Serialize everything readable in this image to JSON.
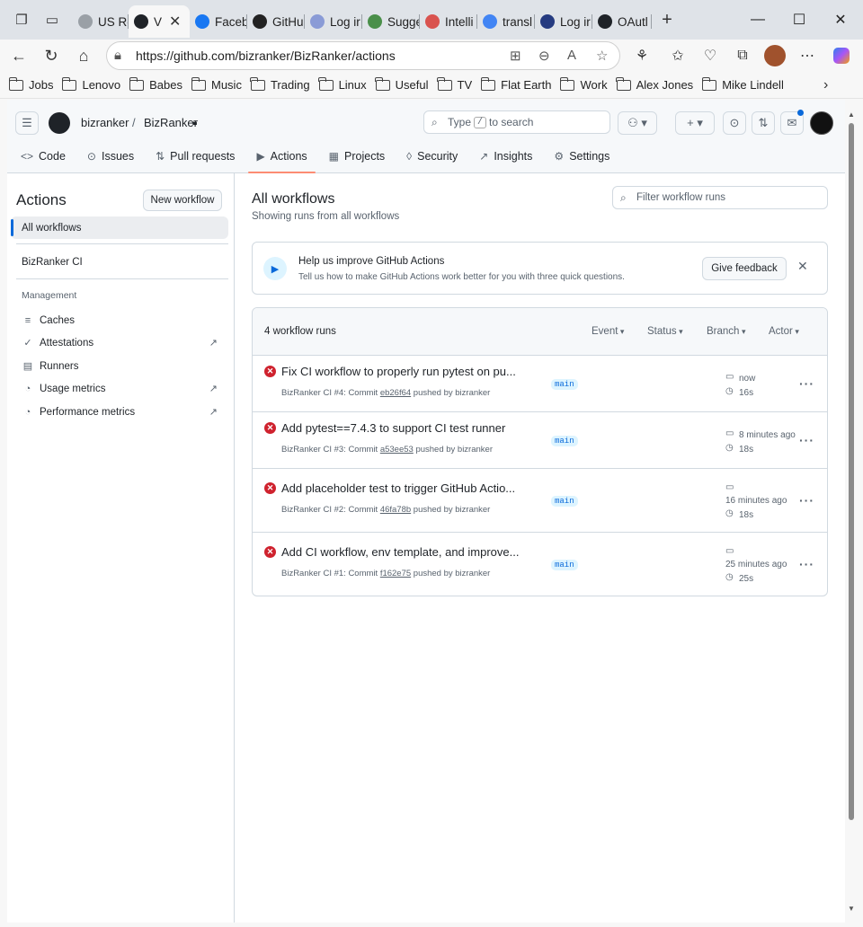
{
  "browser": {
    "tabs": [
      {
        "label": "US Re",
        "icon": "ghost-favicon",
        "color": "#9aa0a6"
      },
      {
        "label": "V",
        "icon": "github-favicon",
        "color": "#1f2328",
        "active": true
      },
      {
        "label": "Faceb",
        "icon": "facebook-favicon",
        "color": "#1877f2"
      },
      {
        "label": "GitHu",
        "icon": "openai-favicon",
        "color": "#222222"
      },
      {
        "label": "Log ir",
        "icon": "auth-favicon",
        "color": "#8a9bd6"
      },
      {
        "label": "Sugge",
        "icon": "download-favicon",
        "color": "#4a8f4a"
      },
      {
        "label": "Intelli",
        "icon": "d-favicon",
        "color": "#d9534f"
      },
      {
        "label": "transl",
        "icon": "google-favicon",
        "color": "#4285f4"
      },
      {
        "label": "Log ir",
        "icon": "paypal-favicon",
        "color": "#253b80"
      },
      {
        "label": "OAutl",
        "icon": "github-favicon",
        "color": "#1f2328"
      }
    ],
    "url": "https://github.com/bizranker/BizRanker/actions",
    "bookmarks": [
      "Jobs",
      "Lenovo",
      "Babes",
      "Music",
      "Trading",
      "Linux",
      "Useful",
      "TV",
      "Flat Earth",
      "Work",
      "Alex Jones",
      "Mike Lindell"
    ]
  },
  "header": {
    "owner": "bizranker",
    "separator": "/",
    "repo": "BizRanker",
    "search_prefix": "Type",
    "search_key": "/",
    "search_suffix": "to search"
  },
  "repo_nav": [
    {
      "label": "Code",
      "icon": "<>"
    },
    {
      "label": "Issues",
      "icon": "⊙"
    },
    {
      "label": "Pull requests",
      "icon": "⇅"
    },
    {
      "label": "Actions",
      "icon": "▶",
      "selected": true
    },
    {
      "label": "Projects",
      "icon": "▦"
    },
    {
      "label": "Security",
      "icon": "◊"
    },
    {
      "label": "Insights",
      "icon": "↗"
    },
    {
      "label": "Settings",
      "icon": "⚙"
    }
  ],
  "sidebar": {
    "title": "Actions",
    "new_workflow": "New workflow",
    "all_workflows": "All workflows",
    "workflow": "BizRanker CI",
    "management_heading": "Management",
    "management": [
      {
        "label": "Caches",
        "icon": "≡",
        "external": false
      },
      {
        "label": "Attestations",
        "icon": "✓",
        "external": true
      },
      {
        "label": "Runners",
        "icon": "▤",
        "external": false
      },
      {
        "label": "Usage metrics",
        "icon": "◔",
        "external": true
      },
      {
        "label": "Performance metrics",
        "icon": "◔",
        "external": true
      }
    ]
  },
  "main": {
    "title": "All workflows",
    "subtitle": "Showing runs from all workflows",
    "filter_placeholder": "Filter workflow runs",
    "feedback": {
      "title": "Help us improve GitHub Actions",
      "description": "Tell us how to make GitHub Actions work better for you with three quick questions.",
      "button": "Give feedback"
    },
    "runs_count": "4 workflow runs",
    "filters": [
      "Event",
      "Status",
      "Branch",
      "Actor"
    ],
    "runs": [
      {
        "title": "Fix CI workflow to properly run pytest on pu...",
        "meta_prefix": "BizRanker CI #4: Commit",
        "sha": "eb26f64",
        "meta_suffix": "pushed by bizranker",
        "branch": "main",
        "when": "now",
        "duration": "16s"
      },
      {
        "title": "Add pytest==7.4.3 to support CI test runner",
        "meta_prefix": "BizRanker CI #3: Commit",
        "sha": "a53ee53",
        "meta_suffix": "pushed by bizranker",
        "branch": "main",
        "when": "8 minutes ago",
        "duration": "18s"
      },
      {
        "title": "Add placeholder test to trigger GitHub Actio...",
        "meta_prefix": "BizRanker CI #2: Commit",
        "sha": "46fa78b",
        "meta_suffix": "pushed by bizranker",
        "branch": "main",
        "when": "16 minutes ago",
        "duration": "18s"
      },
      {
        "title": "Add CI workflow, env template, and improve...",
        "meta_prefix": "BizRanker CI #1: Commit",
        "sha": "f162e75",
        "meta_suffix": "pushed by bizranker",
        "branch": "main",
        "when": "25 minutes ago",
        "duration": "25s"
      }
    ]
  }
}
